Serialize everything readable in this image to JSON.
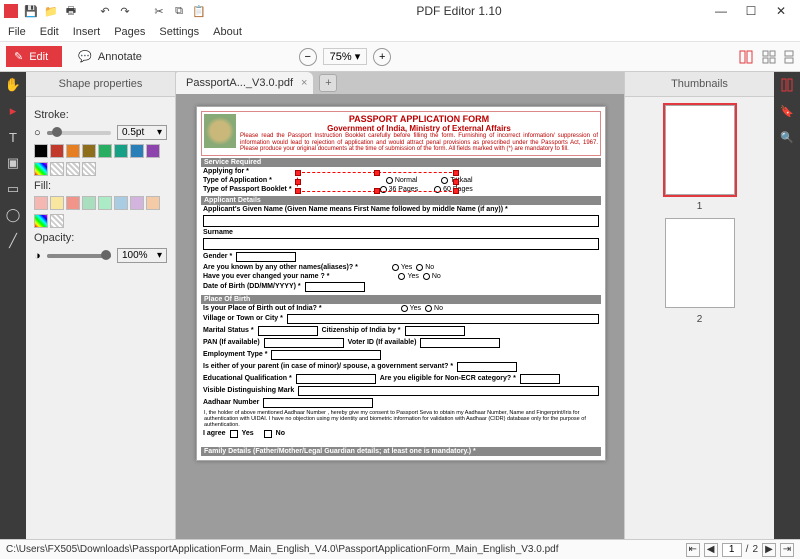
{
  "app": {
    "title": "PDF Editor 1.10"
  },
  "menu": [
    "File",
    "Edit",
    "Insert",
    "Pages",
    "Settings",
    "About"
  ],
  "ribbon": {
    "edit": "Edit",
    "annotate": "Annotate",
    "zoom": "75%"
  },
  "tab": {
    "label": "PassportA..._V3.0.pdf"
  },
  "props": {
    "title": "Shape properties",
    "stroke_label": "Stroke:",
    "stroke_value": "0.5pt",
    "fill_label": "Fill:",
    "opacity_label": "Opacity:",
    "opacity_value": "100%",
    "stroke_swatches": [
      "#000000",
      "#c0392b",
      "#e67e22",
      "#8e6e1a",
      "#27ae60",
      "#16a085",
      "#2980b9",
      "#8e44ad"
    ],
    "fill_swatches": [
      "#f5b7b1",
      "#f9e79f",
      "#f1948a",
      "#a9dfbf",
      "#abebc6",
      "#a9cce3",
      "#d2b4de",
      "#f5cba7"
    ]
  },
  "thumbs": {
    "title": "Thumbnails",
    "labels": [
      "1",
      "2"
    ]
  },
  "status": {
    "path": "C:\\Users\\FX505\\Downloads\\PassportApplicationForm_Main_English_V4.0\\PassportApplicationForm_Main_English_V3.0.pdf",
    "page": "1",
    "total": "2"
  },
  "doc": {
    "title": "PASSPORT APPLICATION FORM",
    "subtitle": "Government of India, Ministry of External Affairs",
    "instruction": "Please read the Passport Instruction Booklet carefully before filling the form. Furnishing of incorrect information/ suppression of information would lead to rejection of application and would attract penal provisions as prescribed under the Passports Act, 1967. Please produce your original documents at the time of submission of the form. All fields marked with (*) are mandatory to fill.",
    "sec_service": "Service Required",
    "applying_for": "Applying for *",
    "type_app": "Type of Application *",
    "opt_normal": "Normal",
    "opt_tatkaal": "Tatkaal",
    "type_booklet": "Type of Passport Booklet *",
    "opt_36": "36 Pages",
    "opt_60": "60 Pages",
    "sec_applicant": "Applicant Details",
    "given_name": "Applicant's Given Name (Given Name means First Name followed by middle Name (if any)) *",
    "surname": "Surname",
    "gender": "Gender *",
    "aliases": "Are you known by any other names(aliases)? *",
    "changed": "Have you ever changed your name ? *",
    "yes": "Yes",
    "no": "No",
    "dob": "Date of Birth (DD/MM/YYYY) *",
    "sec_pob": "Place Of Birth",
    "pob_out": "Is your Place of Birth out of India? *",
    "village": "Village or Town or City *",
    "marital": "Marital Status *",
    "citizenship": "Citizenship of India by *",
    "pan": "PAN (If available)",
    "voter": "Voter ID (If available)",
    "employment": "Employment Type *",
    "parent_govt": "Is either of your parent (in case of minor)/ spouse, a government servant? *",
    "edu": "Educational Qualification *",
    "non_ecr": "Are you eligible for Non-ECR category? *",
    "marks": "Visible Distinguishing Mark",
    "aadhaar": "Aadhaar Number",
    "consent": "I, the holder of above mentioned Aadhaar Number , hereby give my consent to Passport Seva to obtain my Aadhaar Number, Name and Fingerprint/Iris for authentication with UIDAI. I have no objection using my identity and biometric information for validation with Aadhaar (CIDR) database only for the purpose of authentication.",
    "agree": "I agree",
    "sec_family": "Family Details (Father/Mother/Legal Guardian details; at least one is mandatory.) *"
  }
}
